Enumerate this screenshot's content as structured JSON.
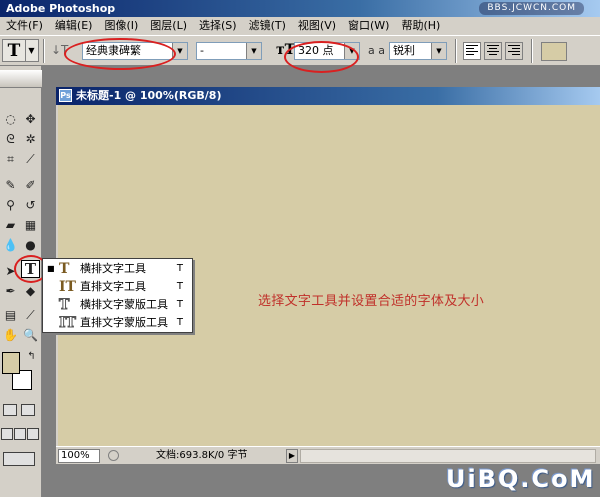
{
  "app": {
    "title": "Adobe Photoshop",
    "watermark_top": "BBS.JCWCN.COM",
    "watermark_bottom": "UiBQ.CoM"
  },
  "menubar": {
    "items": [
      "文件(F)",
      "编辑(E)",
      "图像(I)",
      "图层(L)",
      "选择(S)",
      "滤镜(T)",
      "视图(V)",
      "窗口(W)",
      "帮助(H)"
    ]
  },
  "options": {
    "tool_letter": "T",
    "font_family": "经典隶碑繁",
    "font_style": "-",
    "font_size": "320 点",
    "anti_alias_label": "a a",
    "anti_alias": "锐利",
    "text_color": "#d6cca6"
  },
  "document": {
    "title": "未标题-1 @ 100%(RGB/8)",
    "canvas_color": "#d6cca6",
    "annotation": "选择文字工具并设置合适的字体及大小",
    "zoom": "100%",
    "doc_info": "文档:693.8K/0 字节"
  },
  "flyout": {
    "items": [
      {
        "label": "横排文字工具",
        "shortcut": "T",
        "icon": "horizontal-type-icon",
        "selected": true
      },
      {
        "label": "直排文字工具",
        "shortcut": "T",
        "icon": "vertical-type-icon",
        "selected": false
      },
      {
        "label": "横排文字蒙版工具",
        "shortcut": "T",
        "icon": "horizontal-type-mask-icon",
        "selected": false
      },
      {
        "label": "直排文字蒙版工具",
        "shortcut": "T",
        "icon": "vertical-type-mask-icon",
        "selected": false
      }
    ]
  },
  "colors": {
    "highlight_circle": "#d92020",
    "annotation_text": "#c0302a",
    "foreground": "#d6cca6",
    "background": "#ffffff"
  }
}
